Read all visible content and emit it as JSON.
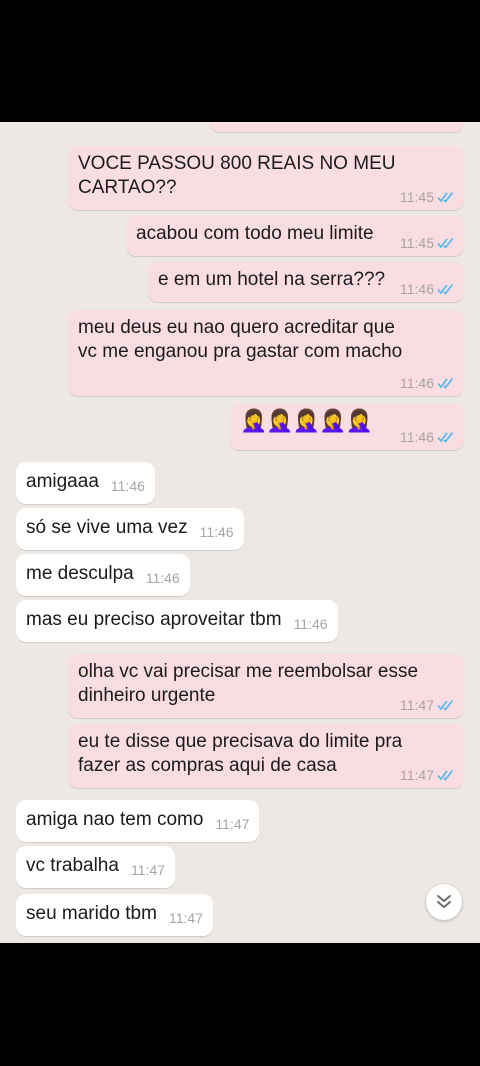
{
  "colors": {
    "outgoing": "#f9dde3",
    "incoming": "#ffffff",
    "read_ticks": "#4fb6ec",
    "background": "#ede8e4"
  },
  "messages": [
    {
      "dir": "out",
      "text": "VOCE PASSOU 800 REAIS NO MEU\nCARTAO??",
      "time": "11:45"
    },
    {
      "dir": "out",
      "text": "acabou com todo meu limite",
      "time": "11:45"
    },
    {
      "dir": "out",
      "text": "e em um hotel na serra???",
      "time": "11:46"
    },
    {
      "dir": "out",
      "text": "meu deus eu nao quero acreditar que\nvc me enganou pra gastar com macho",
      "time": "11:46"
    },
    {
      "dir": "out",
      "text": "🤦‍♀️🤦‍♀️🤦‍♀️🤦‍♀️🤦‍♀️",
      "time": "11:46"
    },
    {
      "dir": "in",
      "text": "amigaaa",
      "time": "11:46"
    },
    {
      "dir": "in",
      "text": "só se vive uma vez",
      "time": "11:46"
    },
    {
      "dir": "in",
      "text": "me desculpa",
      "time": "11:46"
    },
    {
      "dir": "in",
      "text": "mas eu preciso aproveitar tbm",
      "time": "11:46"
    },
    {
      "dir": "out",
      "text": "olha vc vai precisar me reembolsar esse\ndinheiro urgente",
      "time": "11:47"
    },
    {
      "dir": "out",
      "text": "eu te disse que precisava do limite pra\nfazer as compras aqui de casa",
      "time": "11:47"
    },
    {
      "dir": "in",
      "text": "amiga nao tem como",
      "time": "11:47"
    },
    {
      "dir": "in",
      "text": "vc trabalha",
      "time": "11:47"
    },
    {
      "dir": "in",
      "text": "seu marido tbm",
      "time": "11:47"
    }
  ],
  "scroll_button_icon": "double-chevron-down-icon"
}
